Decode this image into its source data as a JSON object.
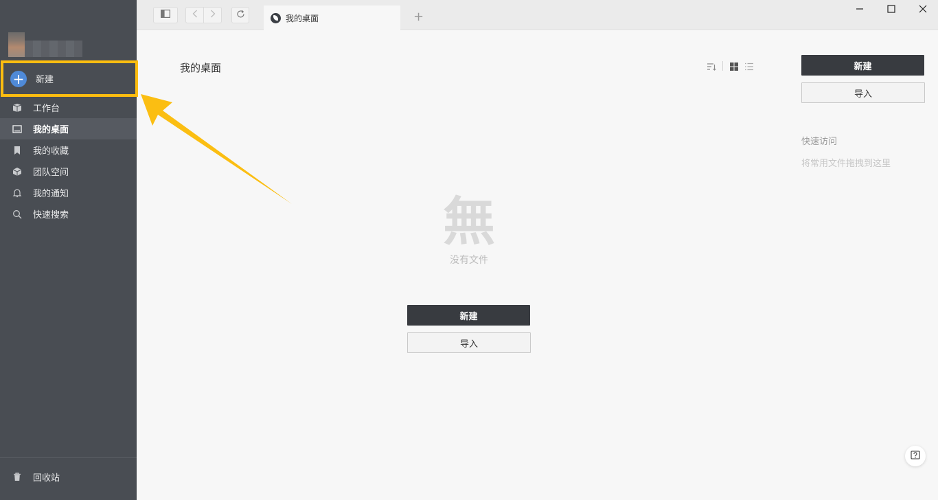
{
  "sidebar": {
    "new_label": "新建",
    "items": [
      {
        "label": "工作台",
        "icon": "box-icon"
      },
      {
        "label": "我的桌面",
        "icon": "desktop-icon",
        "active": true
      },
      {
        "label": "我的收藏",
        "icon": "bookmark-icon"
      },
      {
        "label": "团队空间",
        "icon": "cube-icon"
      },
      {
        "label": "我的通知",
        "icon": "bell-icon"
      },
      {
        "label": "快速搜索",
        "icon": "search-icon"
      }
    ],
    "trash_label": "回收站"
  },
  "topbar": {
    "tab_title": "我的桌面",
    "add_tab": "+"
  },
  "main": {
    "title": "我的桌面",
    "empty_glyph": "無",
    "empty_text": "没有文件",
    "new_button": "新建",
    "import_button": "导入"
  },
  "right_panel": {
    "new_button": "新建",
    "import_button": "导入",
    "quick_access_title": "快速访问",
    "quick_access_hint": "将常用文件拖拽到这里"
  },
  "colors": {
    "sidebar_bg": "#494d53",
    "highlight_border": "#fcbd10",
    "accent_blue": "#4f8ad8",
    "dark_button": "#383b40"
  }
}
